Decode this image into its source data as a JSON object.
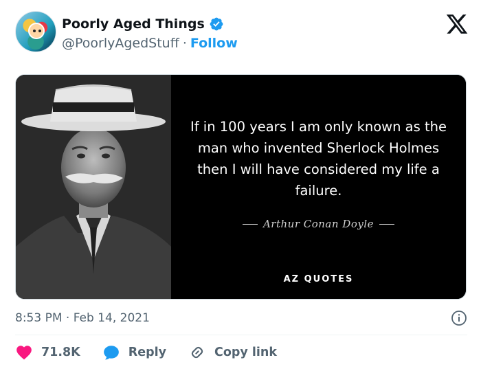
{
  "header": {
    "display_name": "Poorly Aged Things",
    "handle": "@PoorlyAgedStuff",
    "separator": "·",
    "follow_label": "Follow"
  },
  "media": {
    "quote": "If in 100 years I am only known as the man who invented Sherlock Holmes then I will have considered my life a failure.",
    "author": "Arthur Conan Doyle",
    "brand": "AZ QUOTES"
  },
  "meta": {
    "timestamp": "8:53 PM · Feb 14, 2021"
  },
  "actions": {
    "like_count": "71.8K",
    "reply_label": "Reply",
    "copy_link_label": "Copy link"
  },
  "colors": {
    "accent": "#1d9bf0",
    "like": "#f91880",
    "secondary_text": "#536471"
  },
  "icons": [
    "verified-badge-icon",
    "x-logo-icon",
    "info-icon",
    "heart-icon",
    "reply-bubble-icon",
    "link-icon"
  ]
}
